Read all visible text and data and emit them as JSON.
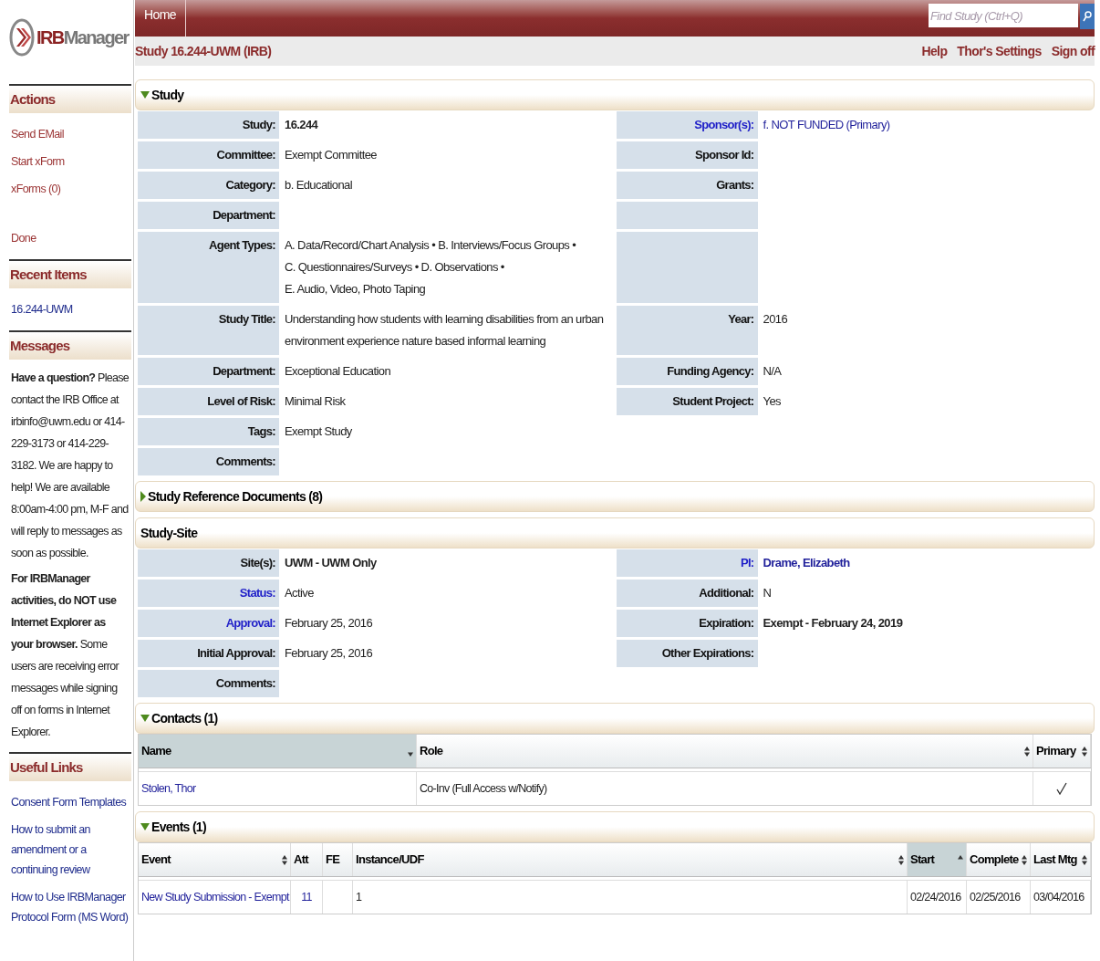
{
  "logo": {
    "part1": "IRB",
    "part2": "Manager"
  },
  "header": {
    "home_tab": "Home",
    "search_placeholder": "Find Study (Ctrl+Q)"
  },
  "breadcrumb": "Study 16.244-UWM (IRB)",
  "top_links": [
    "Help",
    "Thor's Settings",
    "Sign off"
  ],
  "sidebar": [
    {
      "title": "Actions",
      "items": [
        {
          "label": "Send EMail",
          "kind": "action"
        },
        {
          "label": "Start xForm",
          "kind": "action"
        },
        {
          "label": "xForms (0)",
          "kind": "action"
        },
        {
          "label": "Done",
          "kind": "action-spaced"
        }
      ]
    },
    {
      "title": "Recent Items",
      "items": [
        {
          "label": "16.244-UWM",
          "kind": "link"
        }
      ]
    },
    {
      "title": "Messages",
      "paragraphs": [
        "**Have a question?** Please contact the IRB Office at irbinfo@uwm.edu or 414-229-3173 or 414-229-3182. We are happy to help! We are available 8:00am-4:00 pm, M-F and will reply to messages as soon as possible.",
        "**For IRBManager activities, do NOT use Internet Explorer as your browser.** Some users are receiving error messages while signing off on forms in Internet Explorer."
      ]
    },
    {
      "title": "Useful Links",
      "items": [
        {
          "label": "Consent Form Templates",
          "kind": "link"
        },
        {
          "label": "How to submit an amendment or a continuing review",
          "kind": "link"
        },
        {
          "label": "How to Use IRBManager Protocol Form (MS Word)",
          "kind": "link"
        }
      ]
    }
  ],
  "sections": [
    {
      "kind": "fields",
      "title": "Study",
      "expanded": true,
      "rows": [
        {
          "kind": "pair",
          "left": {
            "label": "Study:",
            "link": false,
            "lines": [
              "16.244"
            ],
            "bold": true,
            "value_link": false
          },
          "right": {
            "label": "Sponsor(s):",
            "link": true,
            "lines": [
              "f. NOT FUNDED (Primary)"
            ],
            "bold": false,
            "value_link": true
          }
        },
        {
          "kind": "pair",
          "left": {
            "label": "Committee:",
            "link": false,
            "lines": [
              "Exempt Committee"
            ],
            "bold": false,
            "value_link": false
          },
          "right": {
            "label": "Sponsor Id:",
            "link": false
          }
        },
        {
          "kind": "pair",
          "left": {
            "label": "Category:",
            "link": false,
            "lines": [
              "b. Educational"
            ],
            "bold": false,
            "value_link": false
          },
          "right": {
            "label": "Grants:",
            "link": false
          }
        },
        {
          "kind": "left-only",
          "left": {
            "label": "Department:",
            "link": false
          }
        },
        {
          "kind": "left-only",
          "left": {
            "label": "Agent Types:",
            "link": false,
            "lines": [
              "A. Data/Record/Chart Analysis • B. Interviews/Focus Groups •",
              "C. Questionnaires/Surveys • D. Observations •",
              "E. Audio, Video, Photo Taping"
            ],
            "bold": false,
            "value_link": false
          }
        },
        {
          "kind": "pair",
          "left": {
            "label": "Study Title:",
            "link": false,
            "lines": [
              "Understanding how students with learning disabilities from an urban",
              "environment experience nature based informal learning"
            ],
            "bold": false,
            "value_link": false
          },
          "right": {
            "label": "Year:",
            "link": false,
            "lines": [
              "2016"
            ],
            "bold": false,
            "value_link": false
          }
        },
        {
          "kind": "pair",
          "left": {
            "label": "Department:",
            "link": false,
            "lines": [
              "Exceptional Education"
            ],
            "bold": false,
            "value_link": false
          },
          "right": {
            "label": "Funding Agency:",
            "link": false,
            "lines": [
              "N/A"
            ],
            "bold": false,
            "value_link": false
          }
        },
        {
          "kind": "pair",
          "left": {
            "label": "Level of Risk:",
            "link": false,
            "lines": [
              "Minimal Risk"
            ],
            "bold": false,
            "value_link": false
          },
          "right": {
            "label": "Student Project:",
            "link": false,
            "lines": [
              "Yes"
            ],
            "bold": false,
            "value_link": false
          }
        },
        {
          "kind": "wide",
          "left": {
            "label": "Tags:",
            "link": false,
            "lines": [
              "Exempt Study"
            ],
            "bold": false,
            "value_link": false
          }
        },
        {
          "kind": "wide",
          "left": {
            "label": "Comments:",
            "link": false
          }
        }
      ]
    },
    {
      "kind": "fields",
      "title": "Study Reference Documents (8)",
      "expanded": false
    },
    {
      "kind": "fields",
      "title": "Study-Site",
      "rows": [
        {
          "kind": "pair",
          "left": {
            "label": "Site(s):",
            "link": false,
            "lines": [
              "UWM - UWM Only"
            ],
            "bold": true,
            "value_link": false
          },
          "right": {
            "label": "PI:",
            "link": true,
            "lines": [
              "Drame, Elizabeth"
            ],
            "bold": true,
            "value_link": true
          }
        },
        {
          "kind": "pair",
          "left": {
            "label": "Status:",
            "link": true,
            "lines": [
              "Active"
            ],
            "bold": false,
            "value_link": false
          },
          "right": {
            "label": "Additional:",
            "link": false,
            "lines": [
              "N"
            ],
            "bold": false,
            "value_link": false
          }
        },
        {
          "kind": "pair",
          "left": {
            "label": "Approval:",
            "link": true,
            "lines": [
              "February 25, 2016"
            ],
            "bold": false,
            "value_link": false
          },
          "right": {
            "label": "Expiration:",
            "link": false,
            "lines": [
              "Exempt - February 24, 2019"
            ],
            "bold": true,
            "value_link": false
          }
        },
        {
          "kind": "pair",
          "left": {
            "label": "Initial Approval:",
            "link": false,
            "lines": [
              "February 25, 2016"
            ],
            "bold": false,
            "value_link": false
          },
          "right": {
            "label": "Other Expirations:",
            "link": false
          }
        },
        {
          "kind": "wide",
          "left": {
            "label": "Comments:",
            "link": false
          }
        }
      ]
    },
    {
      "kind": "table",
      "title": "Contacts (1)",
      "expanded": true,
      "columns": [
        {
          "label": "Name",
          "kind": "sort-down",
          "sorted": true
        },
        {
          "label": "Role",
          "kind": "sort-both",
          "sorted": false
        },
        {
          "label": "Primary",
          "kind": "sort-both",
          "sorted": false
        }
      ],
      "rows": [
        [
          {
            "kind": "link",
            "text": "Stolen, Thor"
          },
          {
            "kind": "text",
            "text": "Co-Inv (Full Access w/Notify)"
          },
          {
            "kind": "check",
            "checked": true
          }
        ]
      ]
    },
    {
      "kind": "table",
      "title": "Events (1)",
      "expanded": true,
      "columns": [
        {
          "label": "Event",
          "kind": "sort-both",
          "sorted": false
        },
        {
          "label": "Att",
          "kind": "plain",
          "sorted": false
        },
        {
          "label": "FE",
          "kind": "plain",
          "sorted": false
        },
        {
          "label": "Instance/UDF",
          "kind": "sort-both",
          "sorted": false
        },
        {
          "label": "Start",
          "kind": "sort-up",
          "sorted": true
        },
        {
          "label": "Complete",
          "kind": "sort-both",
          "sorted": false
        },
        {
          "label": "Last Mtg",
          "kind": "sort-both",
          "sorted": false
        }
      ],
      "rows": [
        [
          {
            "kind": "link",
            "text": "New Study Submission - Exempt"
          },
          {
            "kind": "link",
            "text": "11"
          },
          {
            "kind": "empty"
          },
          {
            "kind": "text",
            "text": "1"
          },
          {
            "kind": "text",
            "text": "02/24/2016"
          },
          {
            "kind": "text",
            "text": "02/25/2016"
          },
          {
            "kind": "text",
            "text": "03/04/2016"
          }
        ]
      ]
    }
  ]
}
